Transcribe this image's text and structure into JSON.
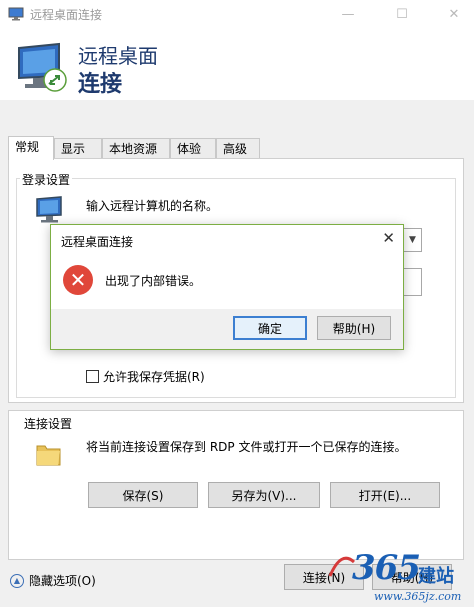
{
  "window": {
    "title": "远程桌面连接",
    "minimize": "—",
    "maximize": "☐",
    "close": "✕"
  },
  "header": {
    "line1": "远程桌面",
    "line2": "连接"
  },
  "tabs": [
    "常规",
    "显示",
    "本地资源",
    "体验",
    "高级"
  ],
  "login_group": {
    "label": "登录设置",
    "prompt": "输入远程计算机的名称。",
    "save_credentials_label": "允许我保存凭据(R)"
  },
  "connection_group": {
    "label": "连接设置",
    "description": "将当前连接设置保存到 RDP 文件或打开一个已保存的连接。",
    "save_button": "保存(S)",
    "save_as_button": "另存为(V)...",
    "open_button": "打开(E)..."
  },
  "footer": {
    "hide_options": "隐藏选项(O)",
    "connect_button": "连接(N)",
    "help_button": "帮助(H)"
  },
  "dialog": {
    "title": "远程桌面连接",
    "close": "✕",
    "message": "出现了内部错误。",
    "ok_button": "确定",
    "help_button": "帮助(H)",
    "error_icon": "✕"
  },
  "watermark": {
    "logo_text": "365",
    "logo_cn": "建站",
    "url": "www.365jz.com"
  },
  "colors": {
    "header_text": "#1e3a6e",
    "dialog_border": "#7cae43",
    "error_red": "#e0473a",
    "ok_border": "#3c7fd1",
    "watermark_blue": "#1a5fb4"
  }
}
